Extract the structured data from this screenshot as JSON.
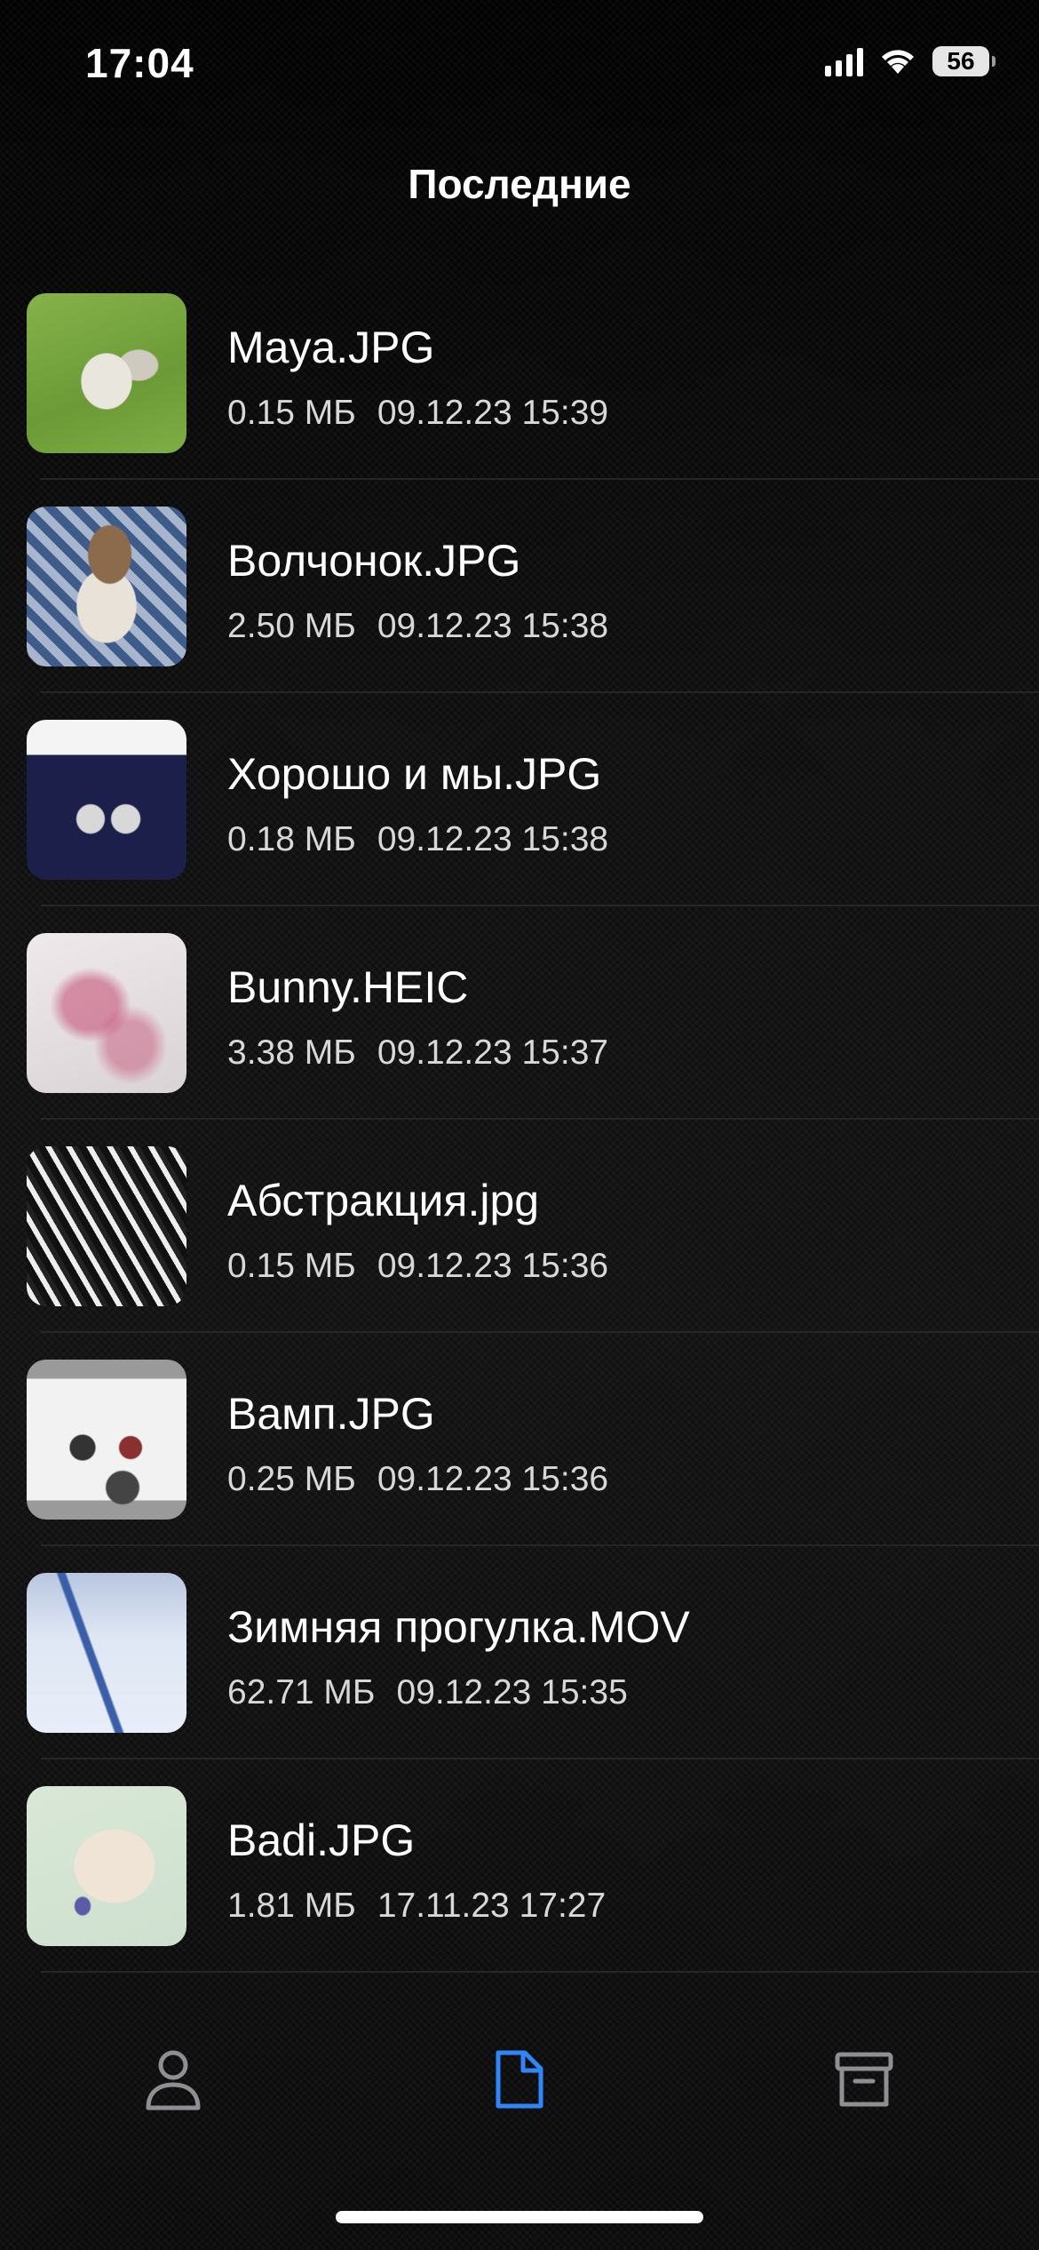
{
  "status_bar": {
    "time": "17:04",
    "battery": "56",
    "icons": [
      "cellular-signal-icon",
      "wifi-icon",
      "battery-icon"
    ]
  },
  "header": {
    "title": "Последние"
  },
  "files": [
    {
      "name": "Maya.JPG",
      "size": "0.15 МБ",
      "date": "09.12.23 15:39"
    },
    {
      "name": "Волчонок.JPG",
      "size": "2.50 МБ",
      "date": "09.12.23 15:38"
    },
    {
      "name": "Хорошо и мы.JPG",
      "size": "0.18 МБ",
      "date": "09.12.23 15:38"
    },
    {
      "name": "Bunny.HEIC",
      "size": "3.38 МБ",
      "date": "09.12.23 15:37"
    },
    {
      "name": "Абстракция.jpg",
      "size": "0.15 МБ",
      "date": "09.12.23 15:36"
    },
    {
      "name": "Вамп.JPG",
      "size": "0.25 МБ",
      "date": "09.12.23 15:36"
    },
    {
      "name": "Зимняя прогулка.MOV",
      "size": "62.71 МБ",
      "date": "09.12.23 15:35"
    },
    {
      "name": "Badi.JPG",
      "size": "1.81 МБ",
      "date": "17.11.23 17:27"
    }
  ],
  "tab_bar": {
    "tabs": [
      {
        "icon": "person-icon",
        "active": false
      },
      {
        "icon": "document-icon",
        "active": true
      },
      {
        "icon": "archive-box-icon",
        "active": false
      }
    ],
    "colors": {
      "active": "#2f86f6",
      "inactive": "#8e8e93"
    }
  }
}
